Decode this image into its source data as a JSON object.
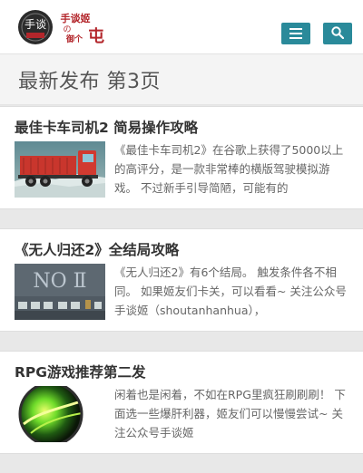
{
  "header": {
    "logo_text_1": "手谈",
    "logo_text_2": "手谈姬",
    "logo_text_3": "の",
    "logo_text_4": "御个",
    "logo_text_5": "屯",
    "menu_icon": "menu-icon",
    "search_icon": "search-icon",
    "accent_color": "#2a8a9a"
  },
  "page": {
    "heading": "最新发布 第3页"
  },
  "posts": [
    {
      "title": "最佳卡车司机2 简易操作攻略",
      "excerpt": "《最佳卡车司机2》在谷歌上获得了5000以上的高评分，是一款非常棒的横版驾驶模拟游戏。 不过新手引导简陋，可能有的",
      "thumb_text": ""
    },
    {
      "title": "《无人归还2》全结局攻略",
      "excerpt": "《无人归还2》有6个结局。 触发条件各不相同。 如果姬友们卡关，可以看看~ 关注公众号手谈姬（shoutanhanhua），",
      "thumb_text": "NO Ⅱ"
    },
    {
      "title": "RPG游戏推荐第二发",
      "excerpt": "闲着也是闲着，不如在RPG里疯狂刷刷刷！ 下面选一些爆肝利器，姬友们可以慢慢尝试~ 关注公众号手谈姬",
      "thumb_text": ""
    }
  ]
}
